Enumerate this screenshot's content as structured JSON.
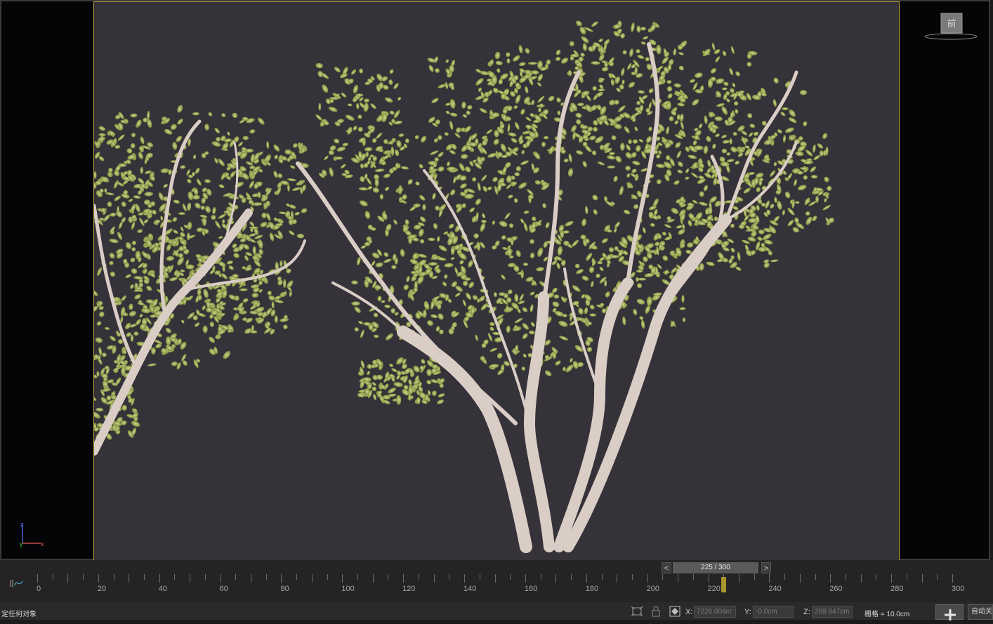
{
  "viewport": {
    "viewcube_label": "前",
    "axes": {
      "z": "z",
      "y": "y",
      "x": "x"
    }
  },
  "timeline": {
    "frame_display": "225 / 300",
    "prev_label": "<",
    "next_label": ">",
    "current_frame": 225,
    "total_frames": 300,
    "tick_labels": [
      "0",
      "20",
      "40",
      "60",
      "80",
      "100",
      "120",
      "140",
      "160",
      "180",
      "200",
      "220",
      "240",
      "260",
      "280",
      "300"
    ]
  },
  "status_bar": {
    "selection_text": "定任何对象",
    "x_label": "X:",
    "x_value": "7226.004cr",
    "y_label": "Y:",
    "y_value": "-0.0cm",
    "z_label": "Z:",
    "z_value": "269.947cm",
    "grid_text": "栅格 = 10.0cm",
    "auto_key_label": "自动关"
  },
  "colors": {
    "viewport_bg": "#353239",
    "frame_border": "#b7a133",
    "leaf": "#c7d47a",
    "bark": "#d9cdc6",
    "playhead": "#a9962c"
  },
  "icons": [
    "curve-editor-icon",
    "maximize-viewport-icon",
    "lock-selection-icon",
    "absolute-mode-icon",
    "set-key-icon"
  ]
}
